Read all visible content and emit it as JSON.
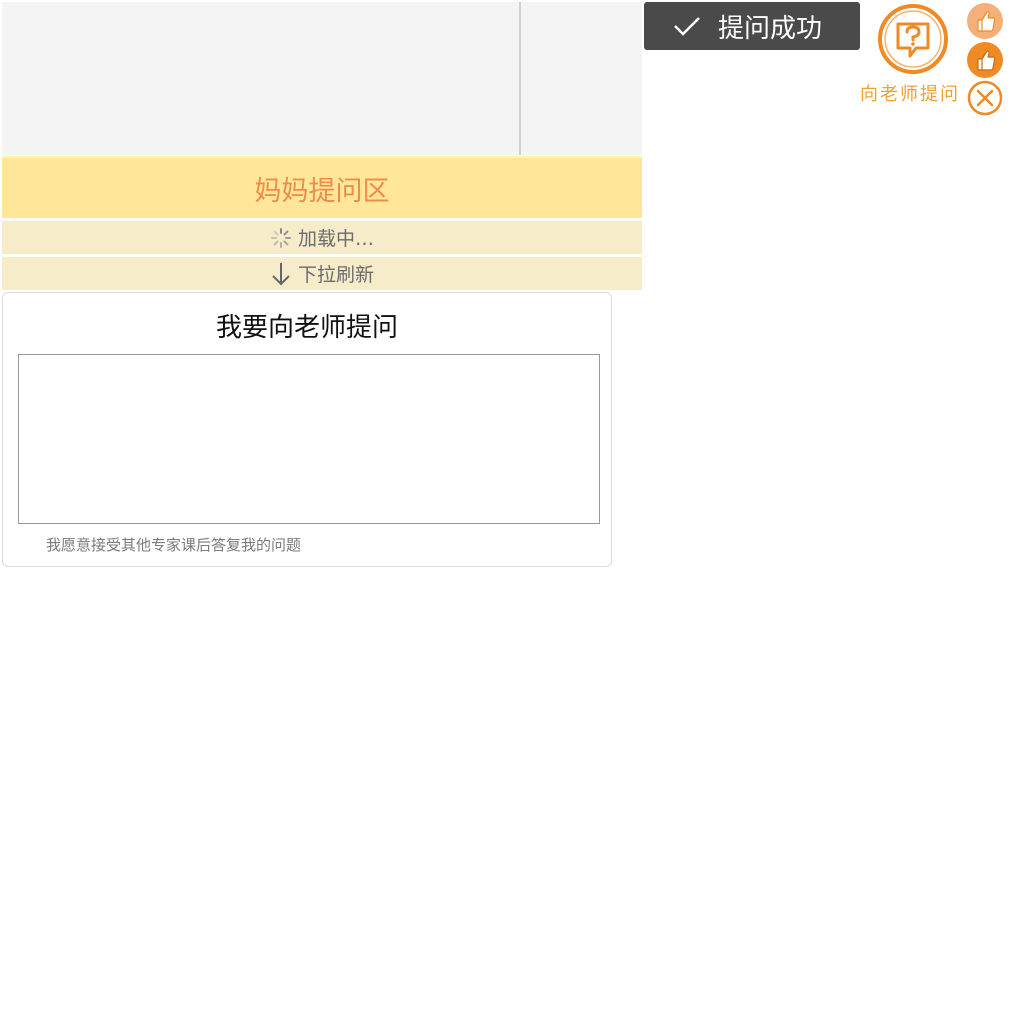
{
  "header": {
    "title": "妈妈提问区"
  },
  "status": {
    "loading": "加载中…",
    "pull_refresh": "下拉刷新"
  },
  "ask_form": {
    "title": "我要向老师提问",
    "textarea_value": "",
    "consent_text": "我愿意接受其他专家课后答复我的问题"
  },
  "toast": {
    "text": "提问成功"
  },
  "floating": {
    "ask_teacher_label": "向老师提问",
    "accent_color": "#f08a24",
    "icons": [
      "question-bubble-icon",
      "thumbs-up-icon",
      "thumbs-up-icon",
      "close-icon"
    ]
  },
  "colors": {
    "header_bg": "#ffe699",
    "header_text": "#f08c4a",
    "status_bg": "#f6ecc9",
    "toast_bg": "#4a4a4a"
  }
}
